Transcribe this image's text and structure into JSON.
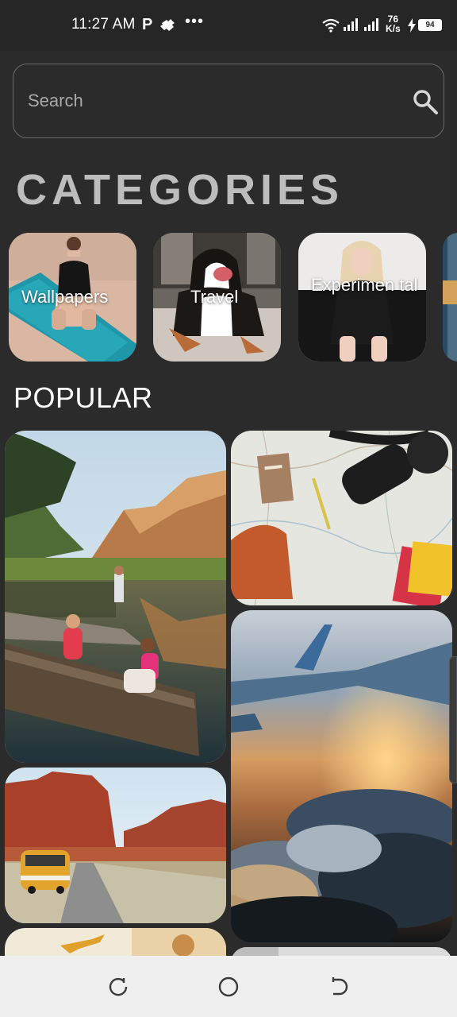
{
  "status_bar": {
    "time": "11:27 AM",
    "notification_letter": "P",
    "more_dots": "•••",
    "net_speed_value": "76",
    "net_speed_unit": "K/s",
    "battery_level": "94"
  },
  "search": {
    "placeholder": "Search",
    "icon": "search-icon"
  },
  "categories": {
    "title": "CATEGORIES",
    "items": [
      {
        "label": "Wallpapers"
      },
      {
        "label": "Travel"
      },
      {
        "label": "Experimen tal"
      },
      {
        "label": ""
      }
    ]
  },
  "popular": {
    "title": "POPULAR"
  },
  "nav_bar": {
    "icons": [
      "recent-apps-icon",
      "home-icon",
      "back-icon"
    ]
  },
  "colors": {
    "background": "#2b2b2b",
    "status_bar": "#262626",
    "nav_bar": "#efefef",
    "categories_title": "#bdbdbd"
  }
}
